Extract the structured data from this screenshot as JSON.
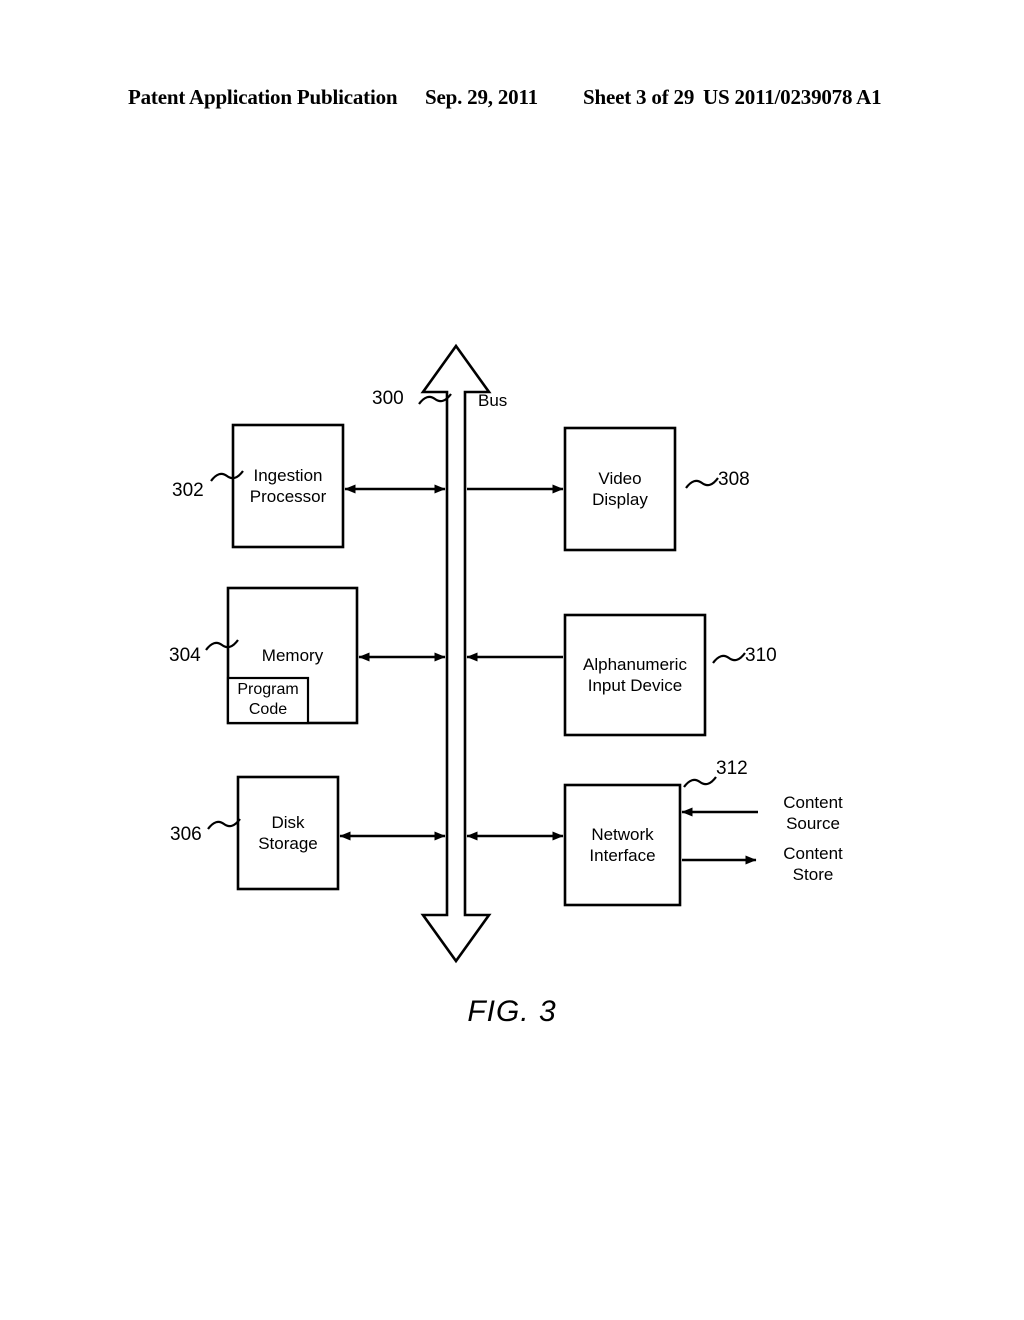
{
  "header": {
    "publication": "Patent Application Publication",
    "date": "Sep. 29, 2011",
    "sheet": "Sheet 3 of 29",
    "patent_number": "US 2011/0239078 A1"
  },
  "figure": {
    "caption": "FIG. 3",
    "bus": {
      "label": "Bus",
      "ref": "300"
    },
    "blocks": [
      {
        "id": "ingestion-processor",
        "label": "Ingestion\nProcessor",
        "ref": "302"
      },
      {
        "id": "memory",
        "label": "Memory",
        "ref": "304"
      },
      {
        "id": "program-code",
        "label": "Program\nCode",
        "ref": ""
      },
      {
        "id": "disk-storage",
        "label": "Disk\nStorage",
        "ref": "306"
      },
      {
        "id": "video-display",
        "label": "Video\nDisplay",
        "ref": "308"
      },
      {
        "id": "alphanumeric-input",
        "label": "Alphanumeric\nInput Device",
        "ref": "310"
      },
      {
        "id": "network-interface",
        "label": "Network\nInterface",
        "ref": "312"
      }
    ],
    "external": [
      {
        "id": "content-source",
        "label": "Content\nSource"
      },
      {
        "id": "content-store",
        "label": "Content\nStore"
      }
    ]
  }
}
